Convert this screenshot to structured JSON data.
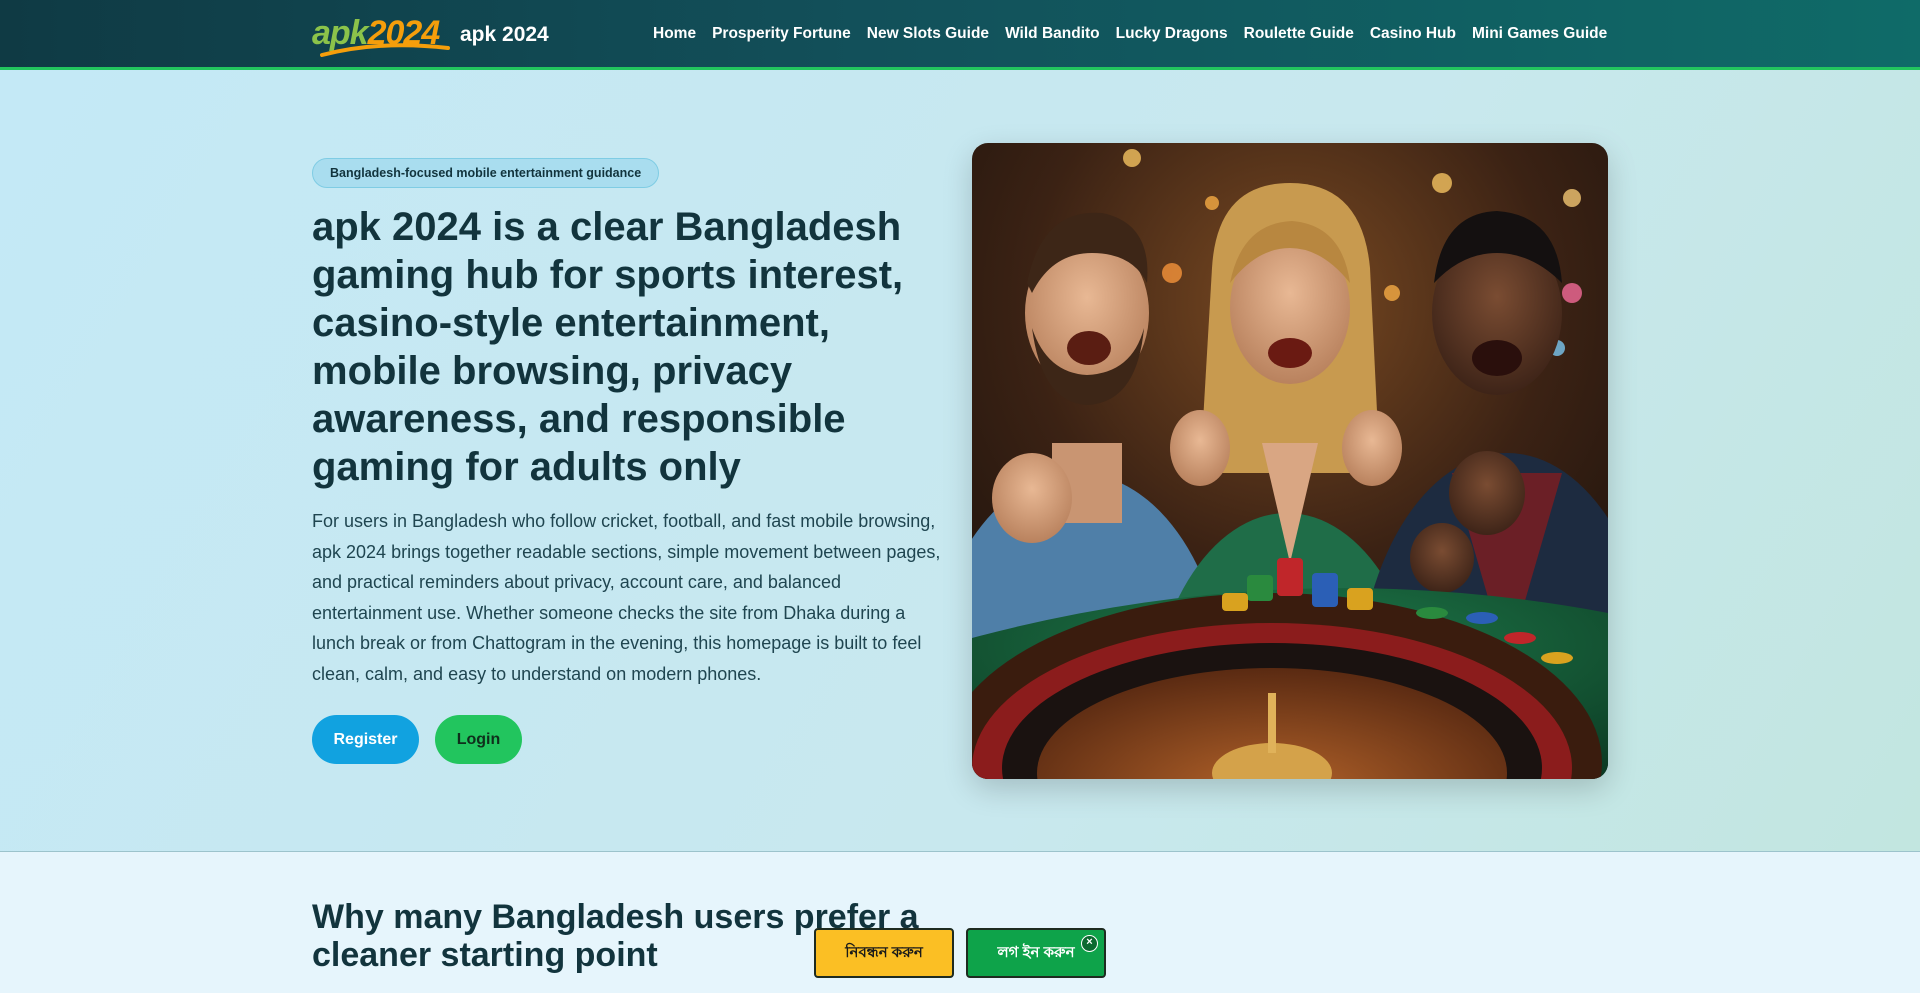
{
  "site": {
    "logo_text_a": "apk",
    "logo_text_b": "2024",
    "name": "apk 2024"
  },
  "nav": {
    "items": [
      {
        "label": "Home"
      },
      {
        "label": "Prosperity Fortune"
      },
      {
        "label": "New Slots Guide"
      },
      {
        "label": "Wild Bandito"
      },
      {
        "label": "Lucky Dragons"
      },
      {
        "label": "Roulette Guide"
      },
      {
        "label": "Casino Hub"
      },
      {
        "label": "Mini Games Guide"
      }
    ]
  },
  "hero": {
    "badge": "Bangladesh-focused mobile entertainment guidance",
    "title": "apk 2024 is a clear Bangladesh gaming hub for sports interest, casino-style entertainment, mobile browsing, privacy awareness, and responsible gaming for adults only",
    "text": "For users in Bangladesh who follow cricket, football, and fast mobile browsing, apk 2024 brings together readable sections, simple movement between pages, and practical reminders about privacy, account care, and balanced entertainment use. Whether someone checks the site from Dhaka during a lunch break or from Chattogram in the evening, this homepage is built to feel clean, calm, and easy to understand on modern phones.",
    "register_label": "Register",
    "login_label": "Login",
    "image_subject": "three-friends-celebrating-at-roulette-table"
  },
  "section2": {
    "title": "Why many Bangladesh users prefer a cleaner starting point"
  },
  "sticky_bar": {
    "register_label": "নিবন্ধন করুন",
    "login_label": "লগ ইন করুন",
    "close_symbol": "×"
  },
  "colors": {
    "header_bg": "#12505a",
    "header_accent": "#22c55e",
    "register_blue": "#11a2e0",
    "login_green": "#22c55e",
    "sticky_yellow": "#fbbf24",
    "sticky_green": "#0ea34a",
    "heading": "#12343d"
  }
}
